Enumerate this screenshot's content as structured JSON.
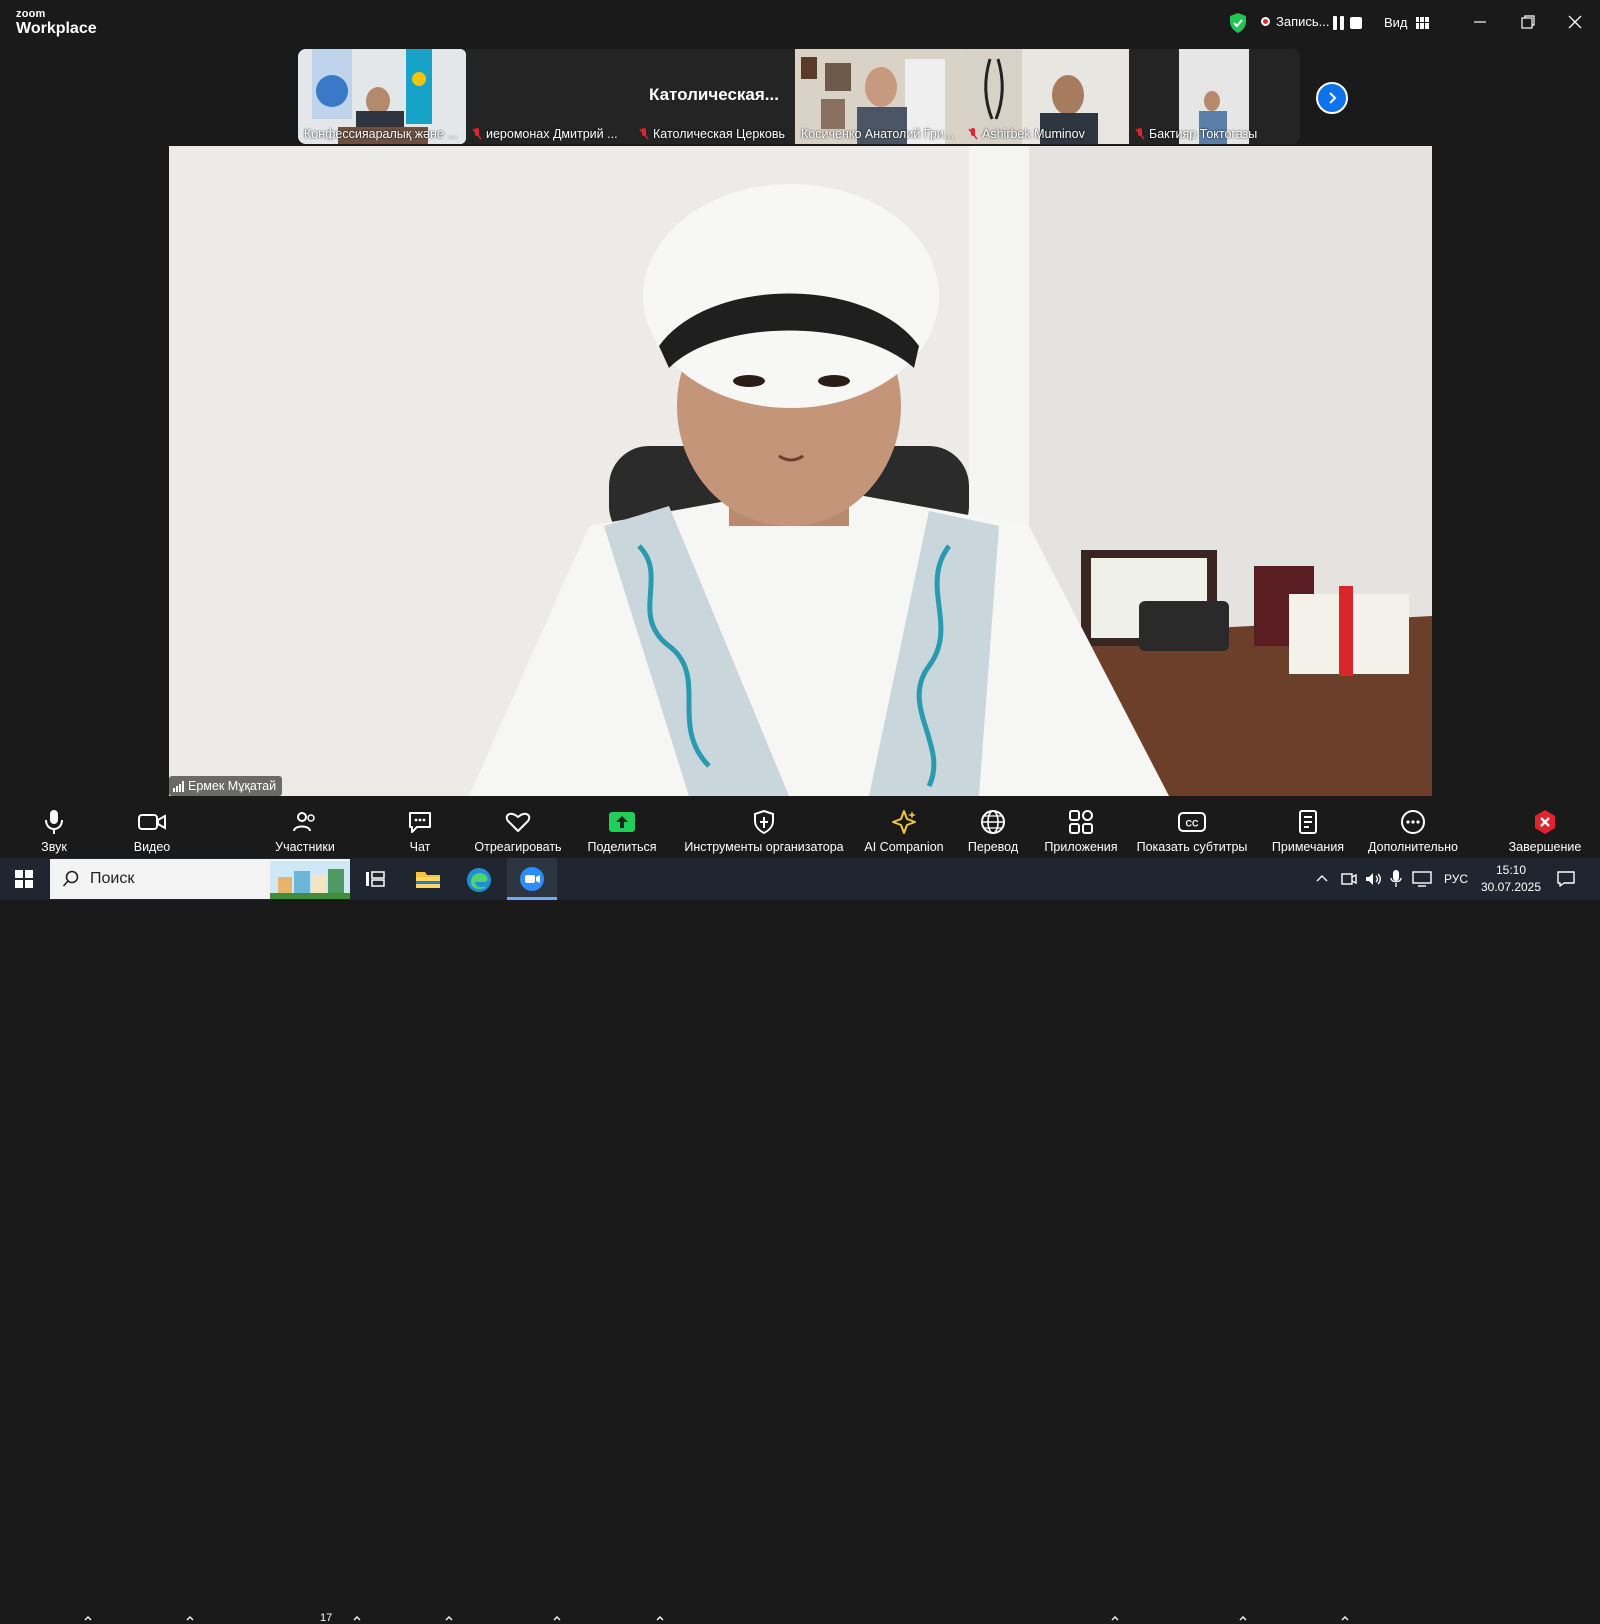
{
  "app": {
    "brand_small": "zoom",
    "brand_large": "Workplace"
  },
  "header": {
    "recording_label": "Запись...",
    "view_label": "Вид"
  },
  "thumbnails": [
    {
      "name": "Конфессияаралық және ...",
      "muted": false,
      "active": true
    },
    {
      "name": "иеромонах Дмитрий ...",
      "muted": true,
      "active": false
    },
    {
      "name": "Католическая Церковь",
      "muted": true,
      "active": false,
      "big_label": "Католическая..."
    },
    {
      "name": "Косиченко Анатолий Гри...",
      "muted": false,
      "active": false
    },
    {
      "name": "Ashirbek Muminov",
      "muted": true,
      "active": false
    },
    {
      "name": "Бактияр Токтогазы",
      "muted": true,
      "active": false
    }
  ],
  "main_video": {
    "speaker_name": "Ермек Мұқатай"
  },
  "toolbar": {
    "audio": "Звук",
    "video": "Видео",
    "participants": "Участники",
    "participants_count": "17",
    "chat": "Чат",
    "react": "Отреагировать",
    "share": "Поделиться",
    "host_tools": "Инструменты организатора",
    "ai_companion": "AI Companion",
    "translate": "Перевод",
    "apps": "Приложения",
    "captions": "Показать субтитры",
    "notes": "Примечания",
    "more": "Дополнительно",
    "end": "Завершение"
  },
  "taskbar": {
    "search_placeholder": "Поиск",
    "language": "РУС",
    "time": "15:10",
    "date": "30.07.2025"
  },
  "colors": {
    "accent_green": "#2ad16f",
    "accent_blue": "#0e72ed",
    "end_red": "#e0242f",
    "share_green": "#1fcf5a"
  }
}
